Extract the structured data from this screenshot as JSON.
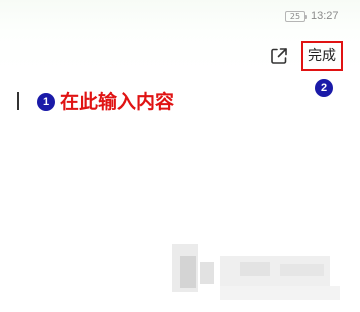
{
  "status_bar": {
    "battery_level": "25",
    "time": "13:27"
  },
  "toolbar": {
    "share_icon": "open-external-icon",
    "done_label": "完成"
  },
  "editor": {
    "placeholder": "在此输入内容"
  },
  "annotations": {
    "step_one": "1",
    "step_two": "2",
    "highlight_color": "#e01313",
    "badge_color": "#1a1aa8"
  }
}
